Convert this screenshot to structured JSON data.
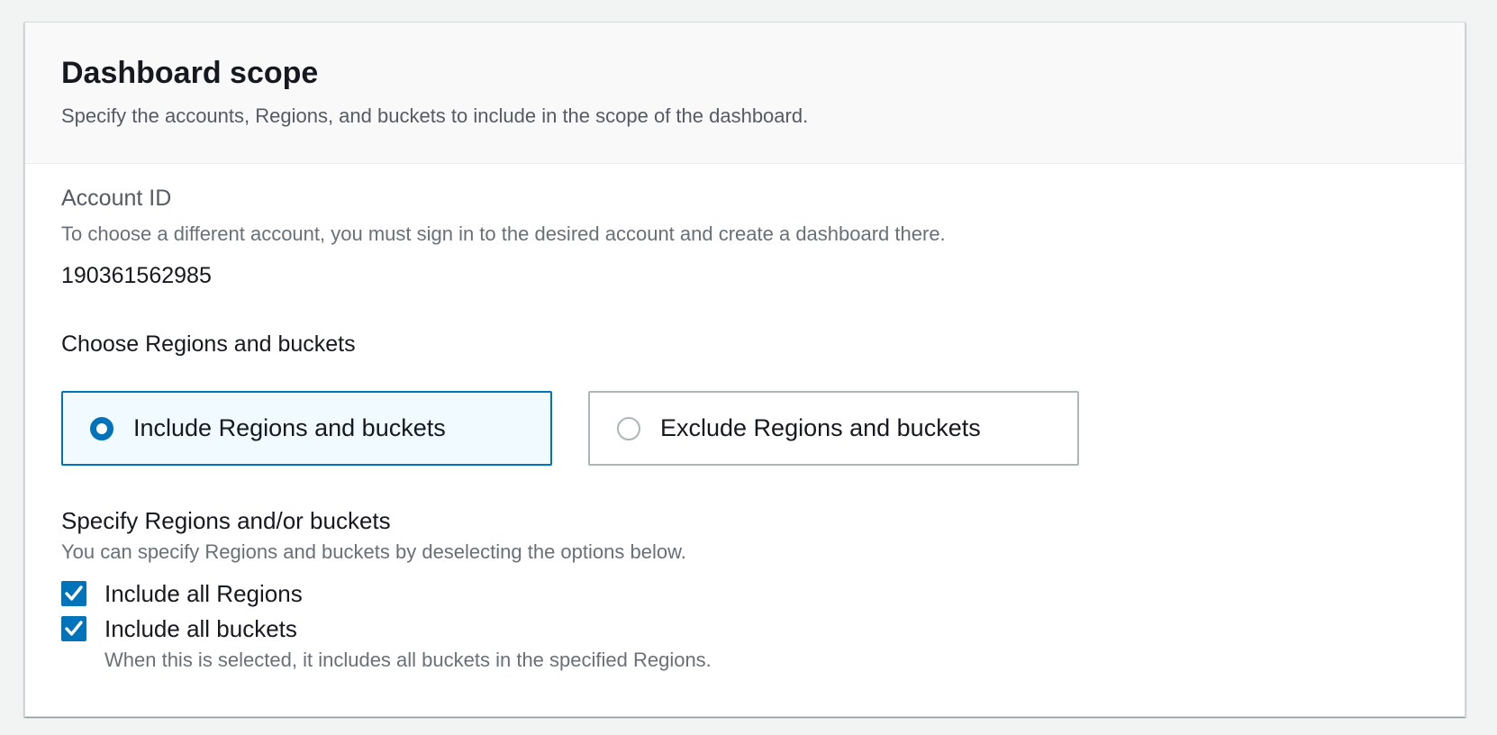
{
  "panel": {
    "title": "Dashboard scope",
    "description": "Specify the accounts, Regions, and buckets to include in the scope of the dashboard."
  },
  "account": {
    "label": "Account ID",
    "help": "To choose a different account, you must sign in to the desired account and create a dashboard there.",
    "value": "190361562985"
  },
  "regions_choice": {
    "label": "Choose Regions and buckets",
    "options": [
      {
        "label": "Include Regions and buckets",
        "selected": true
      },
      {
        "label": "Exclude Regions and buckets",
        "selected": false
      }
    ]
  },
  "specify": {
    "label": "Specify Regions and/or buckets",
    "help": "You can specify Regions and buckets by deselecting the options below.",
    "checkboxes": [
      {
        "label": "Include all Regions",
        "checked": true
      },
      {
        "label": "Include all buckets",
        "checked": true,
        "help": "When this is selected, it includes all buckets in the specified Regions."
      }
    ]
  },
  "colors": {
    "accent": "#0073bb",
    "selected_tile_bg": "#f1faff",
    "text_primary": "#16191f",
    "text_secondary": "#545b64"
  }
}
